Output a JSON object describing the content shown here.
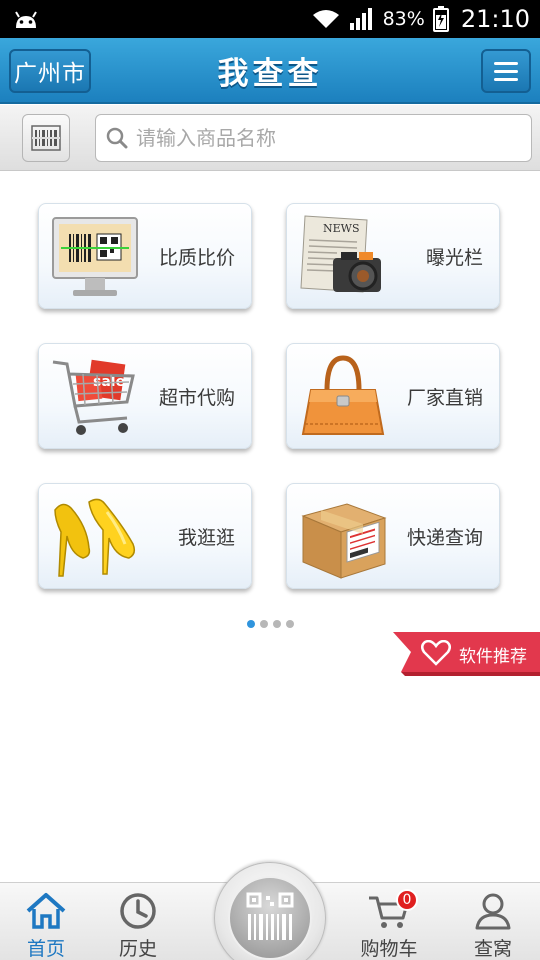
{
  "status_bar": {
    "battery": "83%",
    "time": "21:10",
    "icons": [
      "android-icon",
      "wifi-icon",
      "signal-icon",
      "battery-charging-icon"
    ]
  },
  "header": {
    "city": "广州市",
    "title": "我查查",
    "menu_icon": "hamburger-menu-icon"
  },
  "search": {
    "placeholder": "请输入商品名称",
    "scan_icon": "barcode-icon",
    "search_icon": "search-icon"
  },
  "grid": [
    {
      "label": "比质比价",
      "icon": "barcode-monitor-icon"
    },
    {
      "label": "曝光栏",
      "icon": "newspaper-camera-icon"
    },
    {
      "label": "超市代购",
      "icon": "shopping-cart-icon"
    },
    {
      "label": "厂家直销",
      "icon": "handbag-icon"
    },
    {
      "label": "我逛逛",
      "icon": "high-heels-icon"
    },
    {
      "label": "快递查询",
      "icon": "parcel-box-icon"
    }
  ],
  "pager": {
    "pages": 4,
    "active": 1
  },
  "recommend": {
    "label": "软件推荐",
    "icon": "heart-icon"
  },
  "bottom_nav": {
    "home": "首页",
    "history": "历史",
    "cart": "购物车",
    "cart_count": "0",
    "profile": "查窝",
    "colors": {
      "active": "#1e78c2",
      "inactive": "#555555"
    }
  },
  "colors": {
    "header_blue": "#2a8fcb",
    "ribbon_red": "#e2384d"
  }
}
